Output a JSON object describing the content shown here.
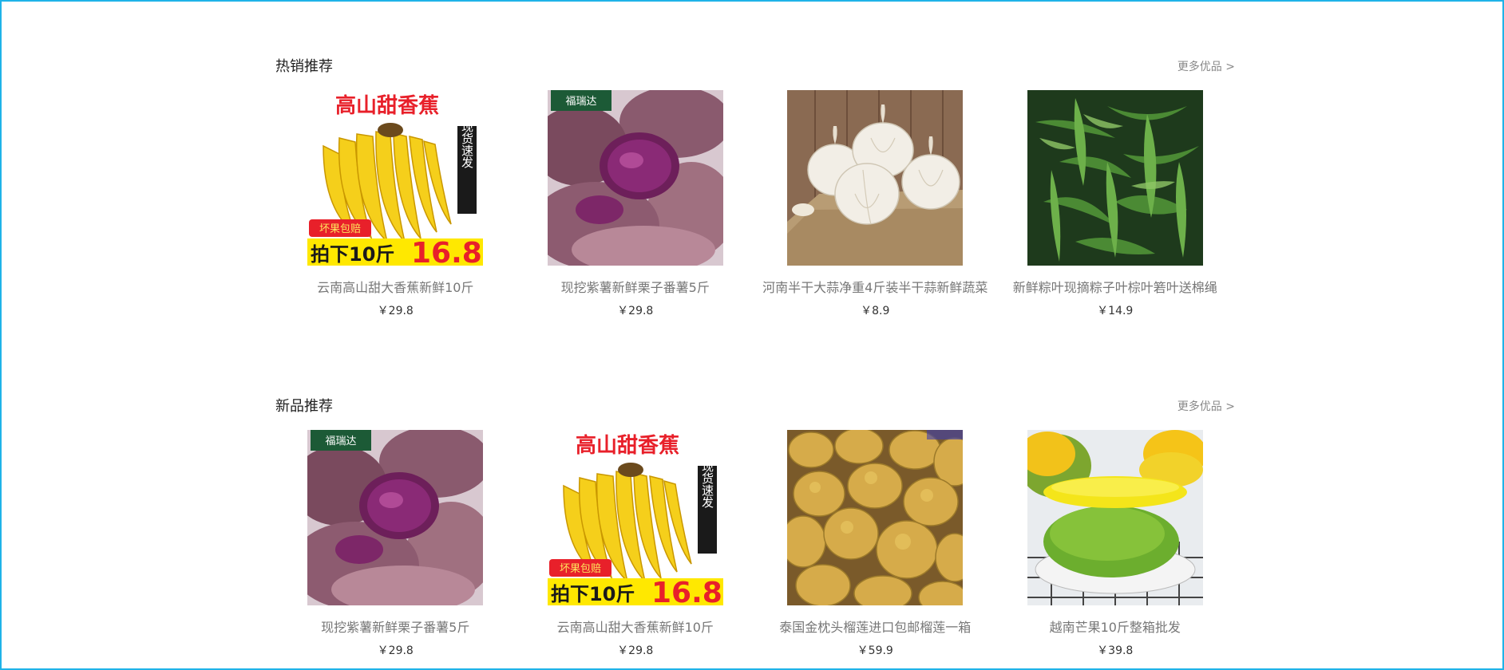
{
  "sections": [
    {
      "title": "热销推荐",
      "more_label": "更多优品 >",
      "products": [
        {
          "name": "云南高山甜大香蕉新鲜10斤",
          "price": "￥29.8",
          "image": "banana-image",
          "promo_top": "高山甜香蕉",
          "promo_side": "现货速发",
          "promo_tag": "坏果包赔",
          "promo_bottom": "拍下10斤",
          "promo_price": "16.8"
        },
        {
          "name": "现挖紫薯新鲜栗子番薯5斤",
          "price": "￥29.8",
          "image": "purple-sweet-potato-image",
          "badge": "福瑞达"
        },
        {
          "name": "河南半干大蒜净重4斤装半干蒜新鲜蔬菜",
          "price": "￥8.9",
          "image": "garlic-image"
        },
        {
          "name": "新鲜粽叶现摘粽子叶棕叶箬叶送棉绳",
          "price": "￥14.9",
          "image": "bamboo-leaves-image"
        }
      ]
    },
    {
      "title": "新品推荐",
      "more_label": "更多优品 >",
      "products": [
        {
          "name": "现挖紫薯新鲜栗子番薯5斤",
          "price": "￥29.8",
          "image": "purple-sweet-potato-image",
          "badge": "福瑞达"
        },
        {
          "name": "云南高山甜大香蕉新鲜10斤",
          "price": "￥29.8",
          "image": "banana-image",
          "promo_top": "高山甜香蕉",
          "promo_side": "现货速发",
          "promo_tag": "坏果包赔",
          "promo_bottom": "拍下10斤",
          "promo_price": "16.8"
        },
        {
          "name": "泰国金枕头榴莲进口包邮榴莲一箱",
          "price": "￥59.9",
          "image": "durian-image"
        },
        {
          "name": "越南芒果10斤整箱批发",
          "price": "￥39.8",
          "image": "mango-image"
        }
      ]
    }
  ]
}
